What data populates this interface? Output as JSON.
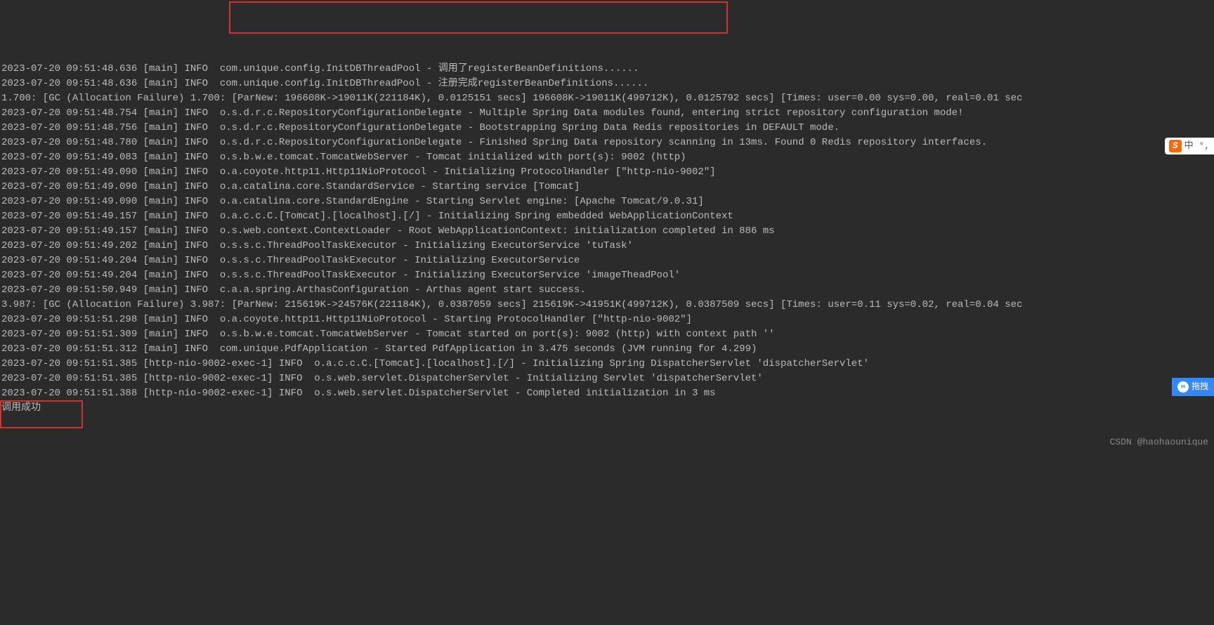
{
  "logs": [
    "2023-07-20 09:51:48.636 [main] INFO  com.unique.config.InitDBThreadPool - 调用了registerBeanDefinitions......",
    "2023-07-20 09:51:48.636 [main] INFO  com.unique.config.InitDBThreadPool - 注册完成registerBeanDefinitions......",
    "1.700: [GC (Allocation Failure) 1.700: [ParNew: 196608K->19011K(221184K), 0.0125151 secs] 196608K->19011K(499712K), 0.0125792 secs] [Times: user=0.00 sys=0.00, real=0.01 sec",
    "2023-07-20 09:51:48.754 [main] INFO  o.s.d.r.c.RepositoryConfigurationDelegate - Multiple Spring Data modules found, entering strict repository configuration mode!",
    "2023-07-20 09:51:48.756 [main] INFO  o.s.d.r.c.RepositoryConfigurationDelegate - Bootstrapping Spring Data Redis repositories in DEFAULT mode.",
    "2023-07-20 09:51:48.780 [main] INFO  o.s.d.r.c.RepositoryConfigurationDelegate - Finished Spring Data repository scanning in 13ms. Found 0 Redis repository interfaces.",
    "2023-07-20 09:51:49.083 [main] INFO  o.s.b.w.e.tomcat.TomcatWebServer - Tomcat initialized with port(s): 9002 (http)",
    "2023-07-20 09:51:49.090 [main] INFO  o.a.coyote.http11.Http11NioProtocol - Initializing ProtocolHandler [\"http-nio-9002\"]",
    "2023-07-20 09:51:49.090 [main] INFO  o.a.catalina.core.StandardService - Starting service [Tomcat]",
    "2023-07-20 09:51:49.090 [main] INFO  o.a.catalina.core.StandardEngine - Starting Servlet engine: [Apache Tomcat/9.0.31]",
    "2023-07-20 09:51:49.157 [main] INFO  o.a.c.c.C.[Tomcat].[localhost].[/] - Initializing Spring embedded WebApplicationContext",
    "2023-07-20 09:51:49.157 [main] INFO  o.s.web.context.ContextLoader - Root WebApplicationContext: initialization completed in 886 ms",
    "2023-07-20 09:51:49.202 [main] INFO  o.s.s.c.ThreadPoolTaskExecutor - Initializing ExecutorService 'tuTask'",
    "2023-07-20 09:51:49.204 [main] INFO  o.s.s.c.ThreadPoolTaskExecutor - Initializing ExecutorService",
    "2023-07-20 09:51:49.204 [main] INFO  o.s.s.c.ThreadPoolTaskExecutor - Initializing ExecutorService 'imageTheadPool'",
    "2023-07-20 09:51:50.949 [main] INFO  c.a.a.spring.ArthasConfiguration - Arthas agent start success.",
    "3.987: [GC (Allocation Failure) 3.987: [ParNew: 215619K->24576K(221184K), 0.0387059 secs] 215619K->41951K(499712K), 0.0387509 secs] [Times: user=0.11 sys=0.02, real=0.04 sec",
    "2023-07-20 09:51:51.298 [main] INFO  o.a.coyote.http11.Http11NioProtocol - Starting ProtocolHandler [\"http-nio-9002\"]",
    "2023-07-20 09:51:51.309 [main] INFO  o.s.b.w.e.tomcat.TomcatWebServer - Tomcat started on port(s): 9002 (http) with context path ''",
    "2023-07-20 09:51:51.312 [main] INFO  com.unique.PdfApplication - Started PdfApplication in 3.475 seconds (JVM running for 4.299)",
    "2023-07-20 09:51:51.385 [http-nio-9002-exec-1] INFO  o.a.c.c.C.[Tomcat].[localhost].[/] - Initializing Spring DispatcherServlet 'dispatcherServlet'",
    "2023-07-20 09:51:51.385 [http-nio-9002-exec-1] INFO  o.s.web.servlet.DispatcherServlet - Initializing Servlet 'dispatcherServlet'",
    "2023-07-20 09:51:51.388 [http-nio-9002-exec-1] INFO  o.s.web.servlet.DispatcherServlet - Completed initialization in 3 ms",
    "调用成功"
  ],
  "watermark": "CSDN @haohaounique",
  "ime": {
    "icon": "S",
    "text": "中 °,"
  },
  "baidu": {
    "icon": "∞",
    "text": "拖拽"
  }
}
